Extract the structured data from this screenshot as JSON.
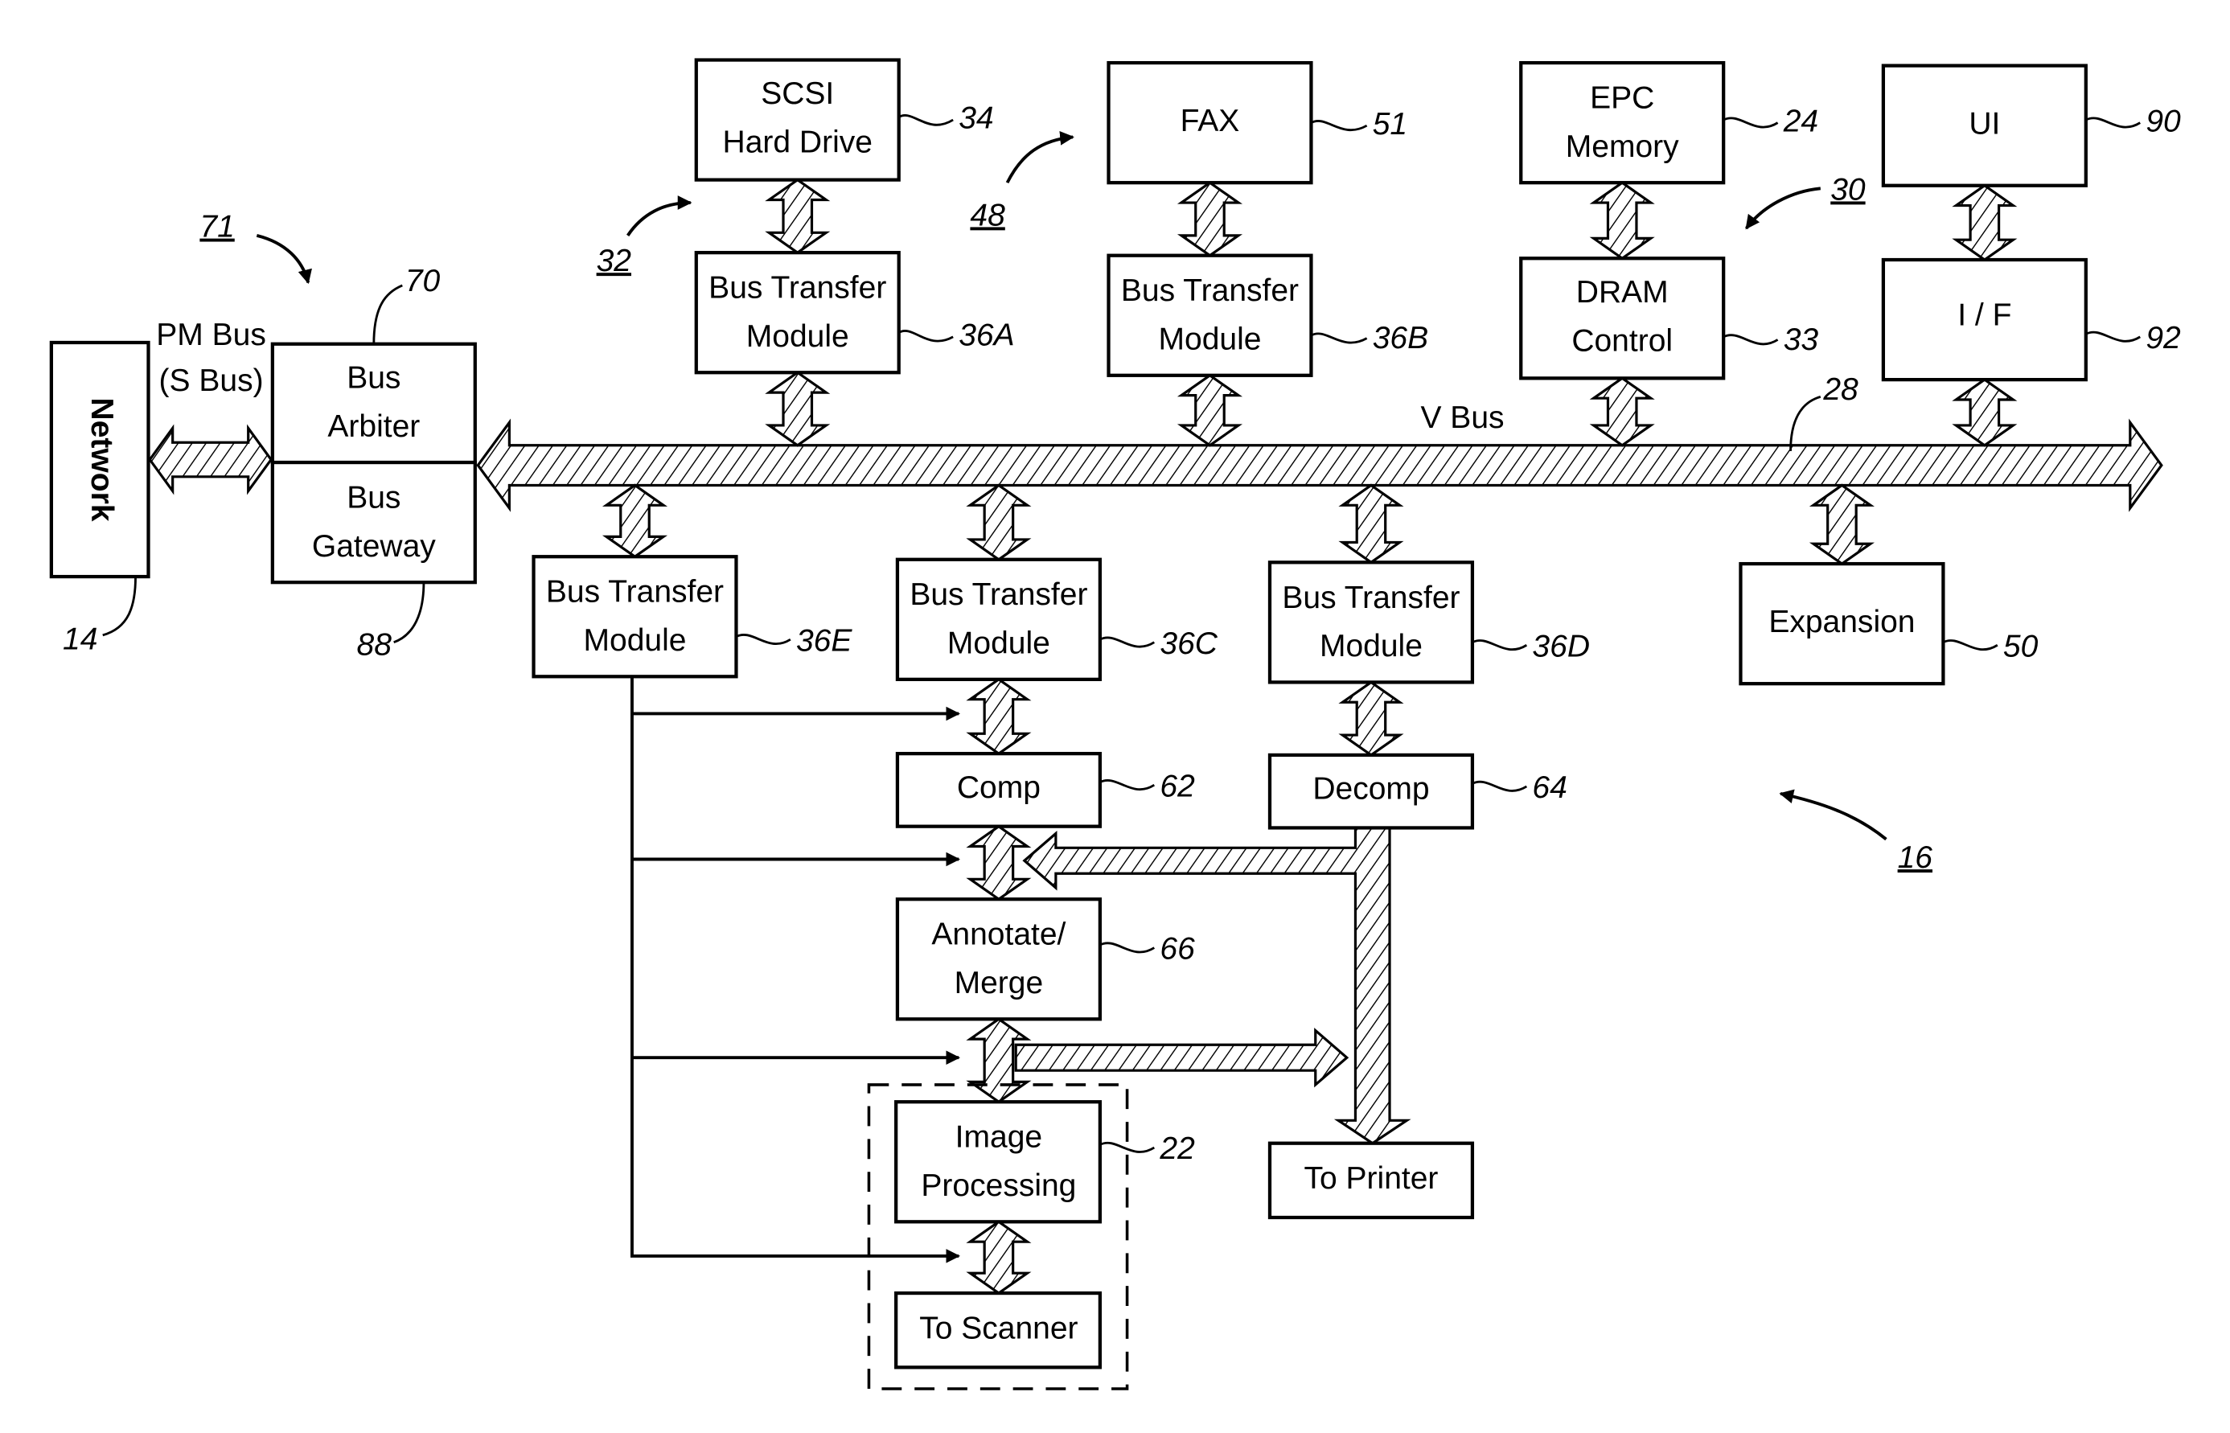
{
  "figure": {
    "ref_label": "16",
    "blocks": {
      "network": {
        "label": "Network",
        "ref": "14"
      },
      "bus_arbiter": {
        "label_line1": "Bus",
        "label_line2": "Arbiter",
        "ref": "70"
      },
      "bus_gateway": {
        "label_line1": "Bus",
        "label_line2": "Gateway",
        "ref": "88"
      },
      "scsi": {
        "label_line1": "SCSI",
        "label_line2": "Hard Drive",
        "ref": "34"
      },
      "btm_a": {
        "label_line1": "Bus Transfer",
        "label_line2": "Module",
        "ref": "36A"
      },
      "fax": {
        "label": "FAX",
        "ref": "51"
      },
      "btm_b": {
        "label_line1": "Bus Transfer",
        "label_line2": "Module",
        "ref": "36B"
      },
      "epc": {
        "label_line1": "EPC",
        "label_line2": "Memory",
        "ref": "24"
      },
      "dram": {
        "label_line1": "DRAM",
        "label_line2": "Control",
        "ref": "33"
      },
      "ui": {
        "label": "UI",
        "ref": "90"
      },
      "iface": {
        "label": "I / F",
        "ref": "92"
      },
      "btm_e": {
        "label_line1": "Bus Transfer",
        "label_line2": "Module",
        "ref": "36E"
      },
      "btm_c": {
        "label_line1": "Bus Transfer",
        "label_line2": "Module",
        "ref": "36C"
      },
      "btm_d": {
        "label_line1": "Bus Transfer",
        "label_line2": "Module",
        "ref": "36D"
      },
      "expansion": {
        "label": "Expansion",
        "ref": "50"
      },
      "comp": {
        "label": "Comp",
        "ref": "62"
      },
      "decomp": {
        "label": "Decomp",
        "ref": "64"
      },
      "annotate": {
        "label_line1": "Annotate/",
        "label_line2": "Merge",
        "ref": "66"
      },
      "image_proc": {
        "label_line1": "Image",
        "label_line2": "Processing",
        "ref": "22"
      },
      "scanner": {
        "label": "To Scanner"
      },
      "printer": {
        "label": "To Printer"
      }
    },
    "buses": {
      "pm_bus_line1": "PM Bus",
      "pm_bus_line2": "(S Bus)",
      "v_bus": "V Bus",
      "v_bus_ref": "28"
    },
    "groups": {
      "g71": "71",
      "g32": "32",
      "g48": "48",
      "g30": "30"
    }
  }
}
